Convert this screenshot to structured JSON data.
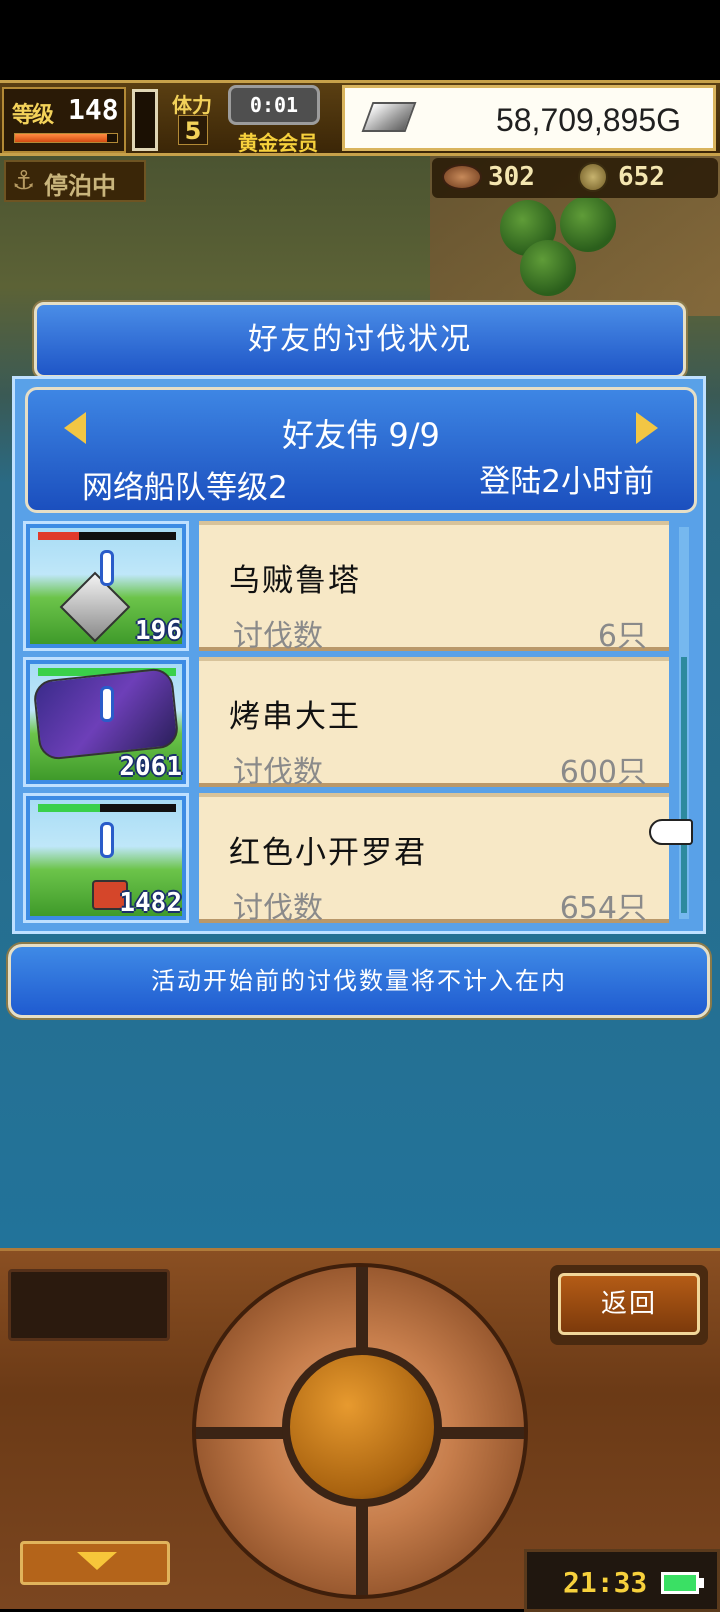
{
  "hud": {
    "level_label": "等级",
    "level_value": "148",
    "level_progress": 0.9,
    "stamina_label": "体力",
    "stamina_value": "5",
    "timer": "0:01",
    "membership": "黄金会员",
    "gold": "58,709,895G"
  },
  "status": {
    "moored_label": "停泊中",
    "resource_a": "302",
    "resource_b": "652"
  },
  "dialog": {
    "title": "好友的讨伐状况",
    "friend_name": "好友伟 9/9",
    "fleet_rank": "网络船队等级2",
    "last_login": "登陆2小时前",
    "notice": "活动开始前的讨伐数量将不计入在内"
  },
  "entries": [
    {
      "name": "乌贼鲁塔",
      "label": "讨伐数",
      "value": "6只",
      "monster_count": "196",
      "hp_fraction": 0.3,
      "hp_color": "#e03a2a"
    },
    {
      "name": "烤串大王",
      "label": "讨伐数",
      "value": "600只",
      "monster_count": "2061",
      "hp_fraction": 1.0,
      "hp_color": "#3ad04a"
    },
    {
      "name": "红色小开罗君",
      "label": "讨伐数",
      "value": "654只",
      "monster_count": "1482",
      "hp_fraction": 0.45,
      "hp_color": "#3ad04a"
    }
  ],
  "controls": {
    "back_label": "返回",
    "clock": "21:33"
  },
  "icons": {
    "arrow_left": "caret-left-icon",
    "arrow_right": "caret-right-icon",
    "hand": "pointer-hand-icon",
    "anchor": "anchor-icon",
    "battery": "battery-icon"
  }
}
